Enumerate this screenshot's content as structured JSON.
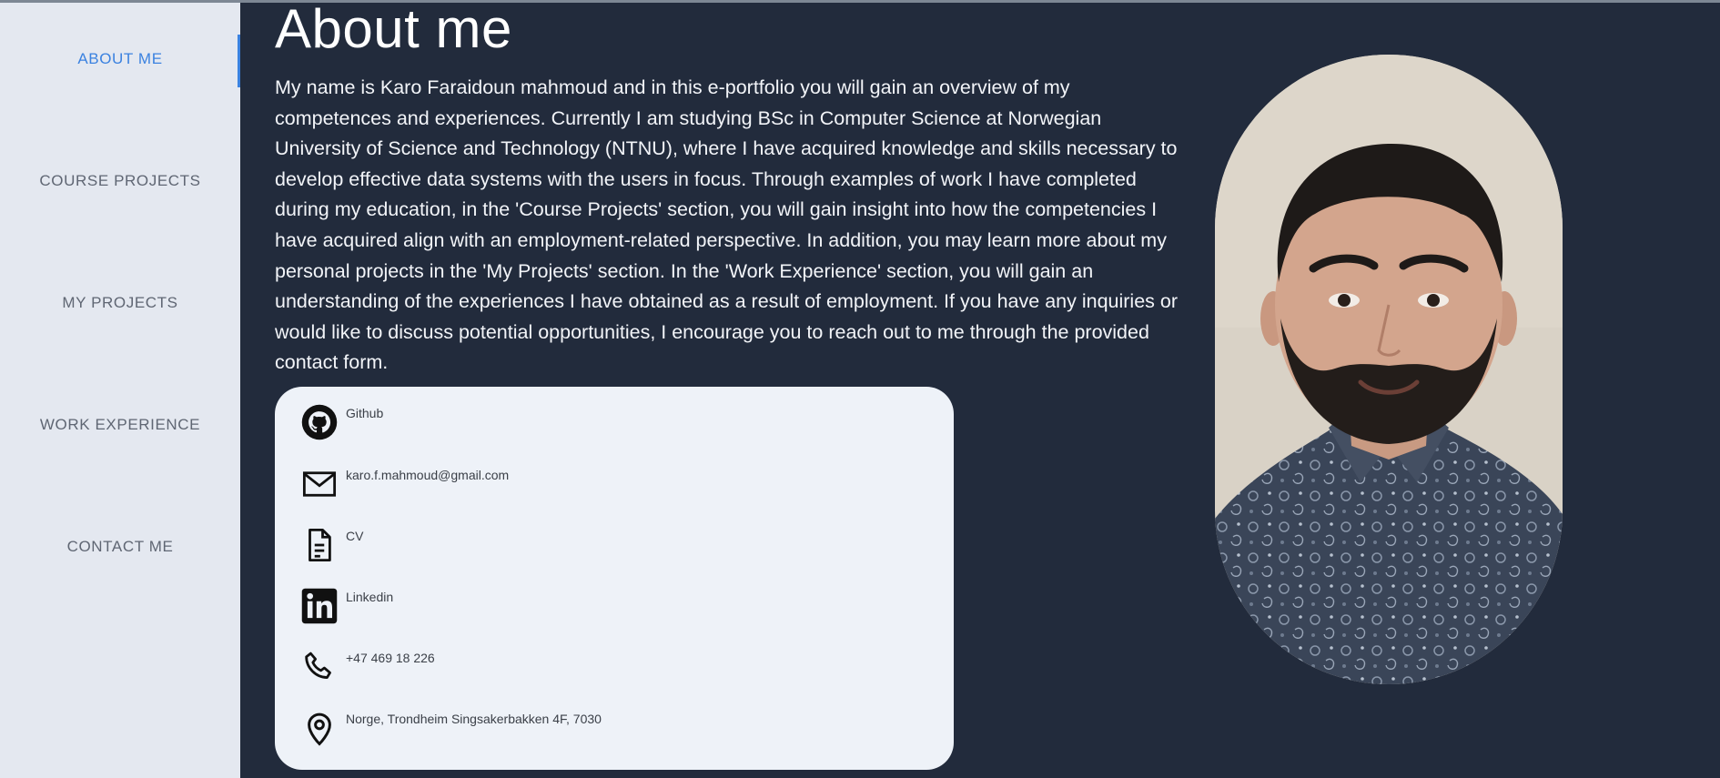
{
  "sidebar": {
    "items": [
      {
        "label": "ABOUT ME",
        "active": true
      },
      {
        "label": "COURSE PROJECTS",
        "active": false
      },
      {
        "label": "MY PROJECTS",
        "active": false
      },
      {
        "label": "WORK EXPERIENCE",
        "active": false
      },
      {
        "label": "CONTACT ME",
        "active": false
      }
    ]
  },
  "main": {
    "title": "About me",
    "intro": "My name is Karo Faraidoun mahmoud and in this e-portfolio you will gain an overview of my competences and experiences. Currently I am studying BSc in Computer Science at Norwegian University of Science and Technology (NTNU), where I have acquired knowledge and skills necessary to develop effective data systems with the users in focus. Through examples of work I have completed during my education, in the 'Course Projects' section, you will gain insight into how the competencies I have acquired align with an employment-related perspective. In addition, you may learn more about my personal projects in the 'My Projects' section. In the 'Work Experience' section, you will gain an understanding of the experiences I have obtained as a result of employment. If you have any inquiries or would like to discuss potential opportunities, I encourage you to reach out to me through the provided contact form.",
    "contacts": [
      {
        "icon": "github-icon",
        "label": "Github"
      },
      {
        "icon": "mail-icon",
        "label": "karo.f.mahmoud@gmail.com"
      },
      {
        "icon": "document-icon",
        "label": "CV"
      },
      {
        "icon": "linkedin-icon",
        "label": "Linkedin"
      },
      {
        "icon": "phone-icon",
        "label": "+47 469 18 226"
      },
      {
        "icon": "location-pin-icon",
        "label": "Norge, Trondheim Singsakerbakken 4F, 7030"
      }
    ]
  },
  "colors": {
    "background": "#222b3c",
    "sidebar": "#e4e8f0",
    "accent": "#3b82e0",
    "card": "#eef2f8"
  }
}
